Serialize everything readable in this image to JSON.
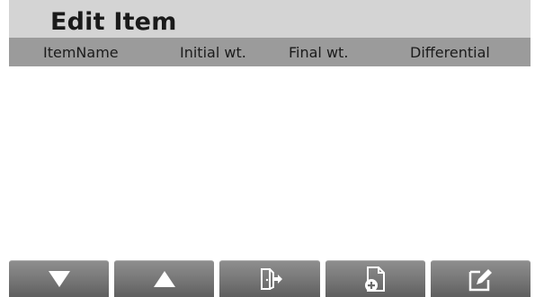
{
  "screen": {
    "title": "Edit Item"
  },
  "table": {
    "columns": [
      "ItemName",
      "Initial wt.",
      "Final wt.",
      "Differential"
    ],
    "rows": []
  },
  "toolbar": {
    "buttons": [
      {
        "icon": "triangle-down-icon"
      },
      {
        "icon": "triangle-up-icon"
      },
      {
        "icon": "exit-door-icon"
      },
      {
        "icon": "add-document-icon"
      },
      {
        "icon": "edit-icon"
      }
    ]
  },
  "colors": {
    "titlebar": "#d4d4d4",
    "header": "#9b9b9b",
    "button": "#7a7a7a"
  }
}
